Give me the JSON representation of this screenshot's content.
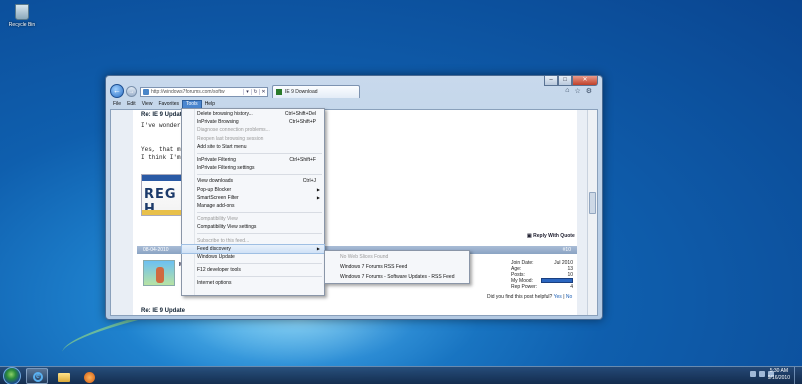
{
  "desktop": {
    "icons": [
      {
        "label": "Recycle Bin",
        "icon": "recycle-bin-icon"
      }
    ]
  },
  "browser": {
    "url": "http://windows7forums.com/softw",
    "tab_title": "IE 9 Download",
    "menubar": [
      "File",
      "Edit",
      "View",
      "Favorites",
      "Tools",
      "Help"
    ],
    "active_menu": "Tools"
  },
  "page": {
    "post_title": "Re: IE 9 Update",
    "post_lines": [
      "I've wondered th",
      "Yes, that my lice",
      "I think I'm on the"
    ],
    "plate_text": "REG H",
    "reply_label": "Reply With Quote",
    "post_date": "08-04-2010",
    "post_number": "#10",
    "poster": "Mu",
    "info_labels": [
      "Join Date:",
      "Age:",
      "Posts:",
      "My Mood:",
      "Rep Power:"
    ],
    "info_values": [
      "Jul 2010",
      "13",
      "10",
      "",
      "4"
    ],
    "helpful_text": "Did you find this post helpful?",
    "helpful_yes": "Yes",
    "helpful_sep": "|",
    "helpful_no": "No",
    "next_post_title": "Re: IE 9 Update"
  },
  "tools_menu": {
    "items": [
      {
        "label": "Delete browsing history...",
        "shortcut": "Ctrl+Shift+Del"
      },
      {
        "label": "InPrivate Browsing",
        "shortcut": "Ctrl+Shift+P"
      },
      {
        "label": "Diagnose connection problems...",
        "shortcut": "",
        "disabled": true
      },
      {
        "label": "Reopen last browsing session",
        "shortcut": "",
        "disabled": true
      },
      {
        "label": "Add site to Start menu",
        "shortcut": ""
      },
      {
        "label": "InPrivate Filtering",
        "shortcut": "Ctrl+Shift+F"
      },
      {
        "label": "InPrivate Filtering settings",
        "shortcut": ""
      },
      {
        "label": "View downloads",
        "shortcut": "Ctrl+J"
      },
      {
        "label": "Pop-up Blocker",
        "shortcut": ""
      },
      {
        "label": "SmartScreen Filter",
        "shortcut": ""
      },
      {
        "label": "Manage add-ons",
        "shortcut": ""
      },
      {
        "label": "Compatibility View",
        "shortcut": "",
        "disabled": true
      },
      {
        "label": "Compatibility View settings",
        "shortcut": ""
      },
      {
        "label": "Subscribe to this feed...",
        "shortcut": "",
        "disabled": true
      },
      {
        "label": "Feed discovery",
        "shortcut": ""
      },
      {
        "label": "Windows Update",
        "shortcut": ""
      },
      {
        "label": "F12 developer tools",
        "shortcut": ""
      },
      {
        "label": "Internet options",
        "shortcut": ""
      }
    ]
  },
  "feed_submenu": {
    "items": [
      {
        "label": "No Web Slices Found",
        "disabled": true
      },
      {
        "label": "Windows 7 Forums RSS Feed"
      },
      {
        "label": "Windows 7 Forums - Software Updates - RSS Feed"
      }
    ]
  },
  "taskbar": {
    "time": "5:30 AM",
    "date": "9/16/2010"
  },
  "colors": {
    "menu_highlight": "#4b86cf",
    "desktop": "#0f5fae"
  }
}
